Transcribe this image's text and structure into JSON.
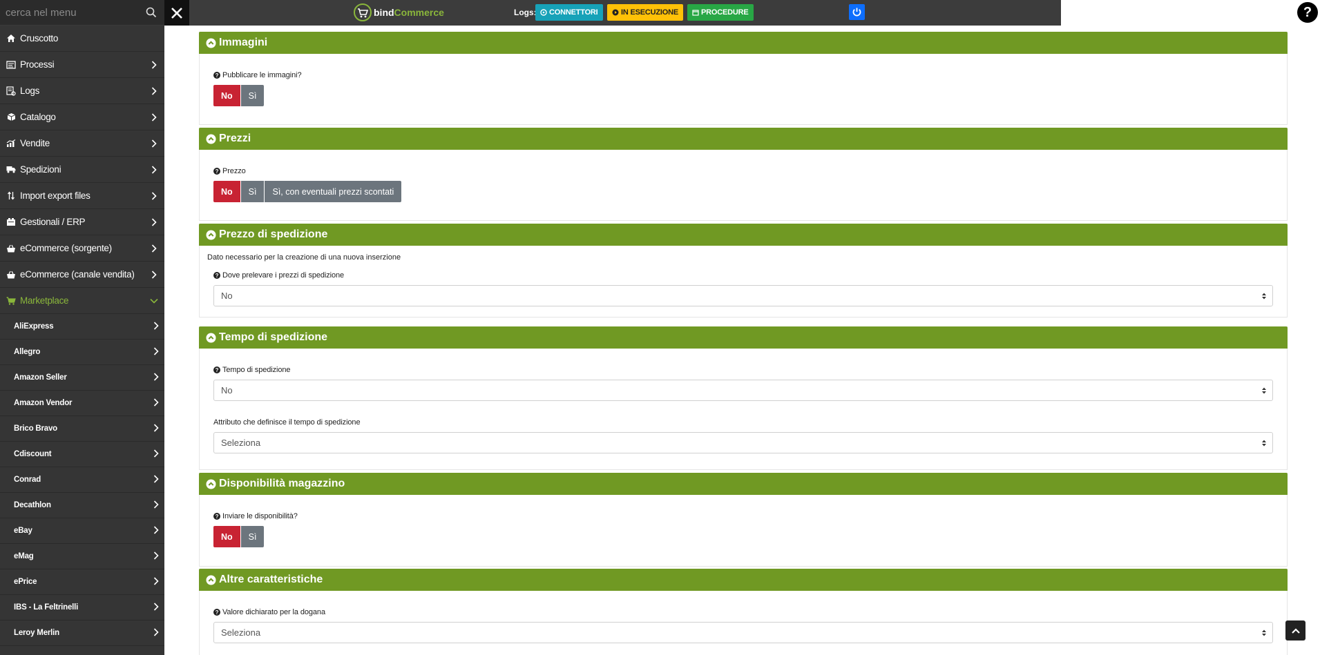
{
  "search": {
    "placeholder": "cerca nel menu"
  },
  "topbar": {
    "logo_part1": "bind",
    "logo_part2": "Commerce",
    "logs_label": "Logs:",
    "btn_connettori": "CONNETTORI",
    "btn_esecuzione": "IN ESECUZIONE",
    "btn_procedure": "PROCEDURE",
    "help_glyph": "?"
  },
  "sidebar": {
    "items": [
      {
        "label": "Cruscotto",
        "icon": "home-icon",
        "chevron": false
      },
      {
        "label": "Processi",
        "icon": "processes-icon",
        "chevron": true
      },
      {
        "label": "Logs",
        "icon": "logs-icon",
        "chevron": true
      },
      {
        "label": "Catalogo",
        "icon": "catalog-icon",
        "chevron": true
      },
      {
        "label": "Vendite",
        "icon": "sales-icon",
        "chevron": true
      },
      {
        "label": "Spedizioni",
        "icon": "truck-icon",
        "chevron": true
      },
      {
        "label": "Import export files",
        "icon": "import-export-icon",
        "chevron": true
      },
      {
        "label": "Gestionali / ERP",
        "icon": "erp-icon",
        "chevron": true
      },
      {
        "label": "eCommerce (sorgente)",
        "icon": "basket-icon",
        "chevron": true
      },
      {
        "label": "eCommerce (canale vendita)",
        "icon": "basket-icon",
        "chevron": true
      },
      {
        "label": "Marketplace",
        "icon": "cart-icon",
        "chevron": true,
        "active": true
      }
    ],
    "subitems": [
      "AliExpress",
      "Allegro",
      "Amazon Seller",
      "Amazon Vendor",
      "Brico Bravo",
      "Cdiscount",
      "Conrad",
      "Decathlon",
      "eBay",
      "eMag",
      "ePrice",
      "IBS - La Feltrinelli",
      "Leroy Merlin"
    ]
  },
  "panels": {
    "immagini": {
      "title": "Immagini",
      "question": "Pubblicare le immagini?",
      "btn_no": "No",
      "btn_si": "Sì"
    },
    "prezzi": {
      "title": "Prezzi",
      "question": "Prezzo",
      "btn_no": "No",
      "btn_si": "Sì",
      "btn_scontati": "Sì, con eventuali prezzi scontati"
    },
    "prezzo_spedizione": {
      "title": "Prezzo di spedizione",
      "note": "Dato necessario per la creazione di una nuova inserzione",
      "question": "Dove prelevare i prezzi di spedizione",
      "select_value": "No"
    },
    "tempo_spedizione": {
      "title": "Tempo di spedizione",
      "question": "Tempo di spedizione",
      "select_value": "No",
      "attr_label": "Attributo che definisce il tempo di spedizione",
      "attr_value": "Seleziona"
    },
    "disponibilita": {
      "title": "Disponibilità magazzino",
      "question": "Inviare le disponibilità?",
      "btn_no": "No",
      "btn_si": "Sì"
    },
    "altre": {
      "title": "Altre caratteristiche",
      "question": "Valore dichiarato per la dogana",
      "select_value": "Seleziona"
    }
  },
  "colors": {
    "accent_green": "#709923",
    "danger_red": "#c82333",
    "sidebar_bg": "#353535",
    "active_green": "#8ab63b"
  }
}
